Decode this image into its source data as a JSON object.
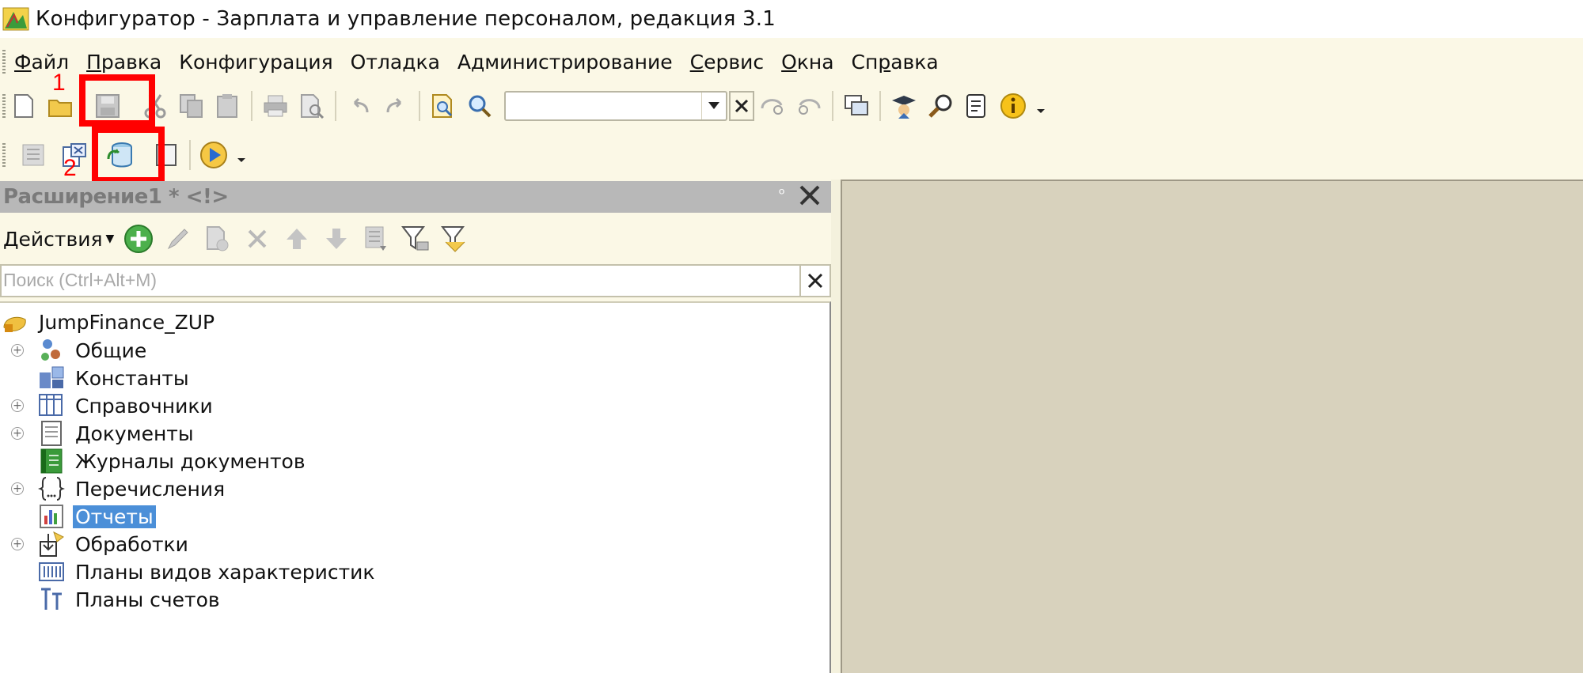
{
  "window": {
    "title": "Конфигуратор - Зарплата и управление персоналом, редакция 3.1"
  },
  "menu": [
    {
      "pre": "",
      "key": "Ф",
      "post": "айл"
    },
    {
      "pre": "",
      "key": "П",
      "post": "равка"
    },
    {
      "pre": "Конфигурация",
      "key": "",
      "post": ""
    },
    {
      "pre": "Отладка",
      "key": "",
      "post": ""
    },
    {
      "pre": "Администрирование",
      "key": "",
      "post": ""
    },
    {
      "pre": "",
      "key": "С",
      "post": "ервис"
    },
    {
      "pre": "",
      "key": "О",
      "post": "кна"
    },
    {
      "pre": "Сп",
      "key": "р",
      "post": "авка"
    }
  ],
  "toolbar": {
    "search_value": ""
  },
  "annotations": {
    "marker1": "1",
    "marker2": "2"
  },
  "panel": {
    "title": "Расширение1 * <!>",
    "actions_label": "Действия",
    "search_placeholder": "Поиск (Ctrl+Alt+M)"
  },
  "tree": {
    "root": "JumpFinance_ZUP",
    "items": [
      {
        "label": "Общие",
        "expandable": true,
        "icon": "common-icon"
      },
      {
        "label": "Константы",
        "expandable": false,
        "icon": "constants-icon"
      },
      {
        "label": "Справочники",
        "expandable": true,
        "icon": "catalogs-icon"
      },
      {
        "label": "Документы",
        "expandable": true,
        "icon": "documents-icon"
      },
      {
        "label": "Журналы документов",
        "expandable": false,
        "icon": "document-journals-icon"
      },
      {
        "label": "Перечисления",
        "expandable": true,
        "icon": "enums-icon"
      },
      {
        "label": "Отчеты",
        "expandable": false,
        "icon": "reports-icon",
        "selected": true
      },
      {
        "label": "Обработки",
        "expandable": true,
        "icon": "data-processors-icon"
      },
      {
        "label": "Планы видов характеристик",
        "expandable": false,
        "icon": "chart-of-characteristic-types-icon"
      },
      {
        "label": "Планы счетов",
        "expandable": false,
        "icon": "chart-of-accounts-icon"
      }
    ]
  },
  "colors": {
    "accent_selection": "#4b8fd8",
    "annotation_red": "#ff0000",
    "workspace": "#d8d2bd"
  }
}
